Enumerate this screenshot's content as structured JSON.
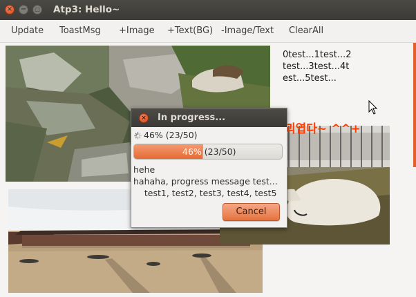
{
  "window": {
    "title": "Atp3: Hello~"
  },
  "menu": {
    "items": [
      {
        "label": "Update"
      },
      {
        "label": "ToastMsg"
      },
      {
        "label": "+Image"
      },
      {
        "label": "+Text(BG)"
      },
      {
        "label": "-Image/Text"
      },
      {
        "label": "ClearAll"
      }
    ]
  },
  "content": {
    "test_lines": "0test...1test...2\ntest...3test...4t\nest...5test...",
    "hangul_text": "괴엽다~ ^^+"
  },
  "dialog": {
    "title": "In progress...",
    "status": "46% (23/50)",
    "progress": {
      "fraction": 0.46,
      "percent_label": "46%",
      "count_label": "(23/50)"
    },
    "message": "hehe\nhahaha, progress message test...\n    test1, test2, test3, test4, test5",
    "cancel_label": "Cancel"
  },
  "colors": {
    "accent": "#e66b34",
    "titlebar": "#3c3b37",
    "hangul_text": "#ff3d00"
  }
}
